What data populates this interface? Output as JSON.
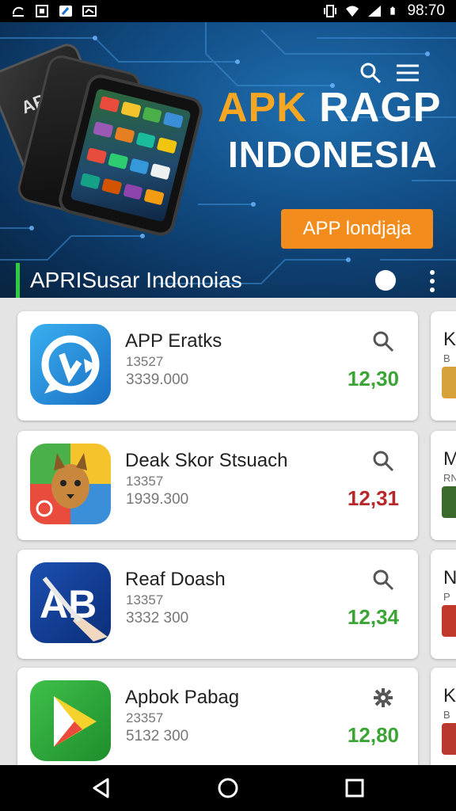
{
  "status_bar": {
    "time": "98:70",
    "left_icons": [
      "sync-icon",
      "sim-icon",
      "app-icon",
      "notification-icon"
    ],
    "right_icons": [
      "vibrate-icon",
      "wifi-icon",
      "signal-icon",
      "battery-icon"
    ]
  },
  "banner": {
    "phone_label": "APP",
    "title_line1_accent": "APK",
    "title_line1_rest": " RAGP",
    "title_line2": "INDONESIA",
    "button_label": "APP londjaja",
    "accent_color": "#f5a623",
    "button_color": "#f28c1c"
  },
  "section": {
    "title": "APRISusar Indonoias",
    "indicator_color": "#2ecc40"
  },
  "apps": [
    {
      "name": "APP Eratks",
      "line1": "13527",
      "line2": "3339.000",
      "value": "12,30",
      "value_color": "#3aa535",
      "action_icon": "search-icon"
    },
    {
      "name": "Deak Skor Stsuach",
      "line1": "13357",
      "line2": "1939.300",
      "value": "12,31",
      "value_color": "#b8282b",
      "action_icon": "search-icon"
    },
    {
      "name": "Reaf Doash",
      "line1": "13357",
      "line2": "3332 300",
      "value": "12,34",
      "value_color": "#3aa535",
      "action_icon": "search-icon"
    },
    {
      "name": "Apbok Pabag",
      "line1": "23357",
      "line2": "5132 300",
      "value": "12,80",
      "value_color": "#3aa535",
      "action_icon": "gear-icon"
    }
  ],
  "peek_cards": [
    {
      "initial": "K",
      "sub": "B"
    },
    {
      "initial": "M",
      "sub": "RN"
    },
    {
      "initial": "N",
      "sub": "P"
    },
    {
      "initial": "K",
      "sub": "B"
    }
  ],
  "nav_bar": {
    "icons": [
      "back-icon",
      "home-icon",
      "recents-icon"
    ]
  }
}
